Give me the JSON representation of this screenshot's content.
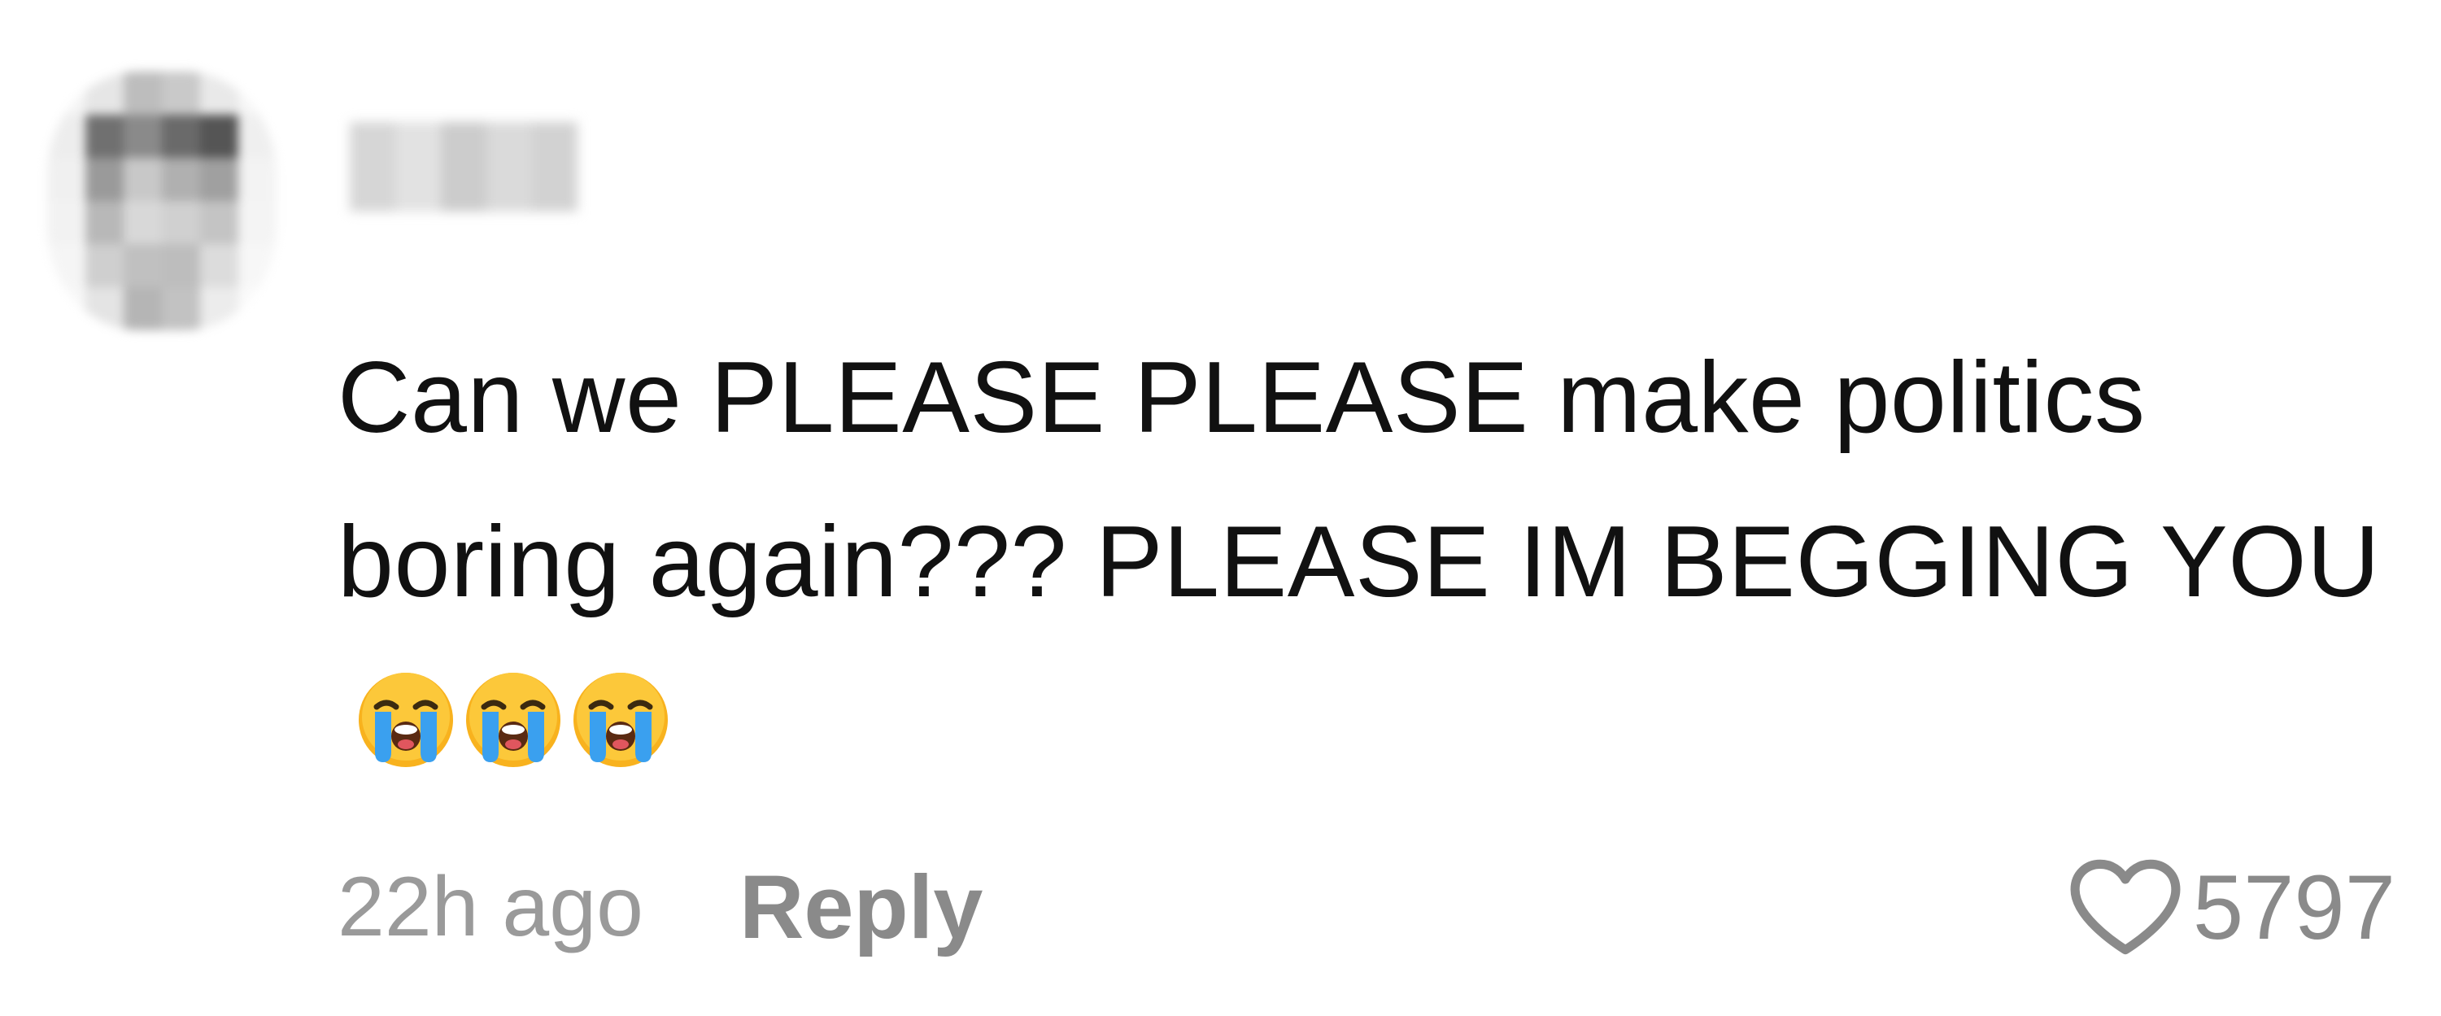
{
  "comment": {
    "text": "Can we PLEASE PLEASE make politics boring again??? PLEASE IM BEGGING YOU",
    "emojis": [
      "loudly-crying-face",
      "loudly-crying-face",
      "loudly-crying-face"
    ],
    "timestamp": "22h ago",
    "reply_label": "Reply",
    "like_count": "5797"
  },
  "colors": {
    "text": "#111111",
    "meta_text": "#9a9a9a",
    "icon": "#8a8a8a"
  },
  "icons": {
    "like": "heart-outline-icon",
    "emoji": "loudly-crying-face-icon"
  }
}
